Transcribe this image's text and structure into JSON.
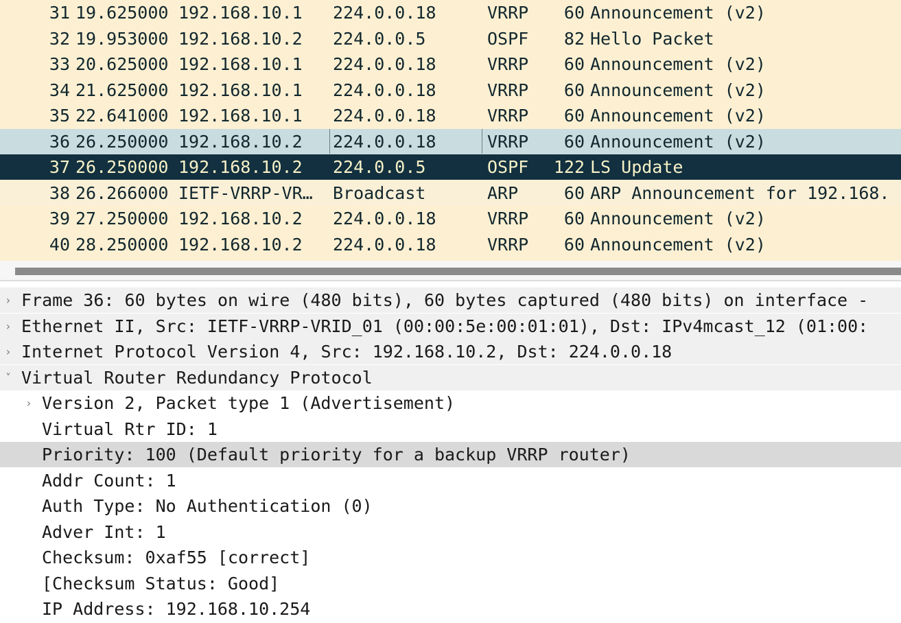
{
  "packet_list": {
    "rows": [
      {
        "no": "31",
        "time": "19.625000",
        "source": "192.168.10.1",
        "destination": "224.0.0.18",
        "protocol": "VRRP",
        "length": "60",
        "info": "Announcement (v2)",
        "style": "vrrp"
      },
      {
        "no": "32",
        "time": "19.953000",
        "source": "192.168.10.2",
        "destination": "224.0.0.5",
        "protocol": "OSPF",
        "length": "82",
        "info": "Hello Packet",
        "style": "ospf"
      },
      {
        "no": "33",
        "time": "20.625000",
        "source": "192.168.10.1",
        "destination": "224.0.0.18",
        "protocol": "VRRP",
        "length": "60",
        "info": "Announcement (v2)",
        "style": "vrrp"
      },
      {
        "no": "34",
        "time": "21.625000",
        "source": "192.168.10.1",
        "destination": "224.0.0.18",
        "protocol": "VRRP",
        "length": "60",
        "info": "Announcement (v2)",
        "style": "vrrp"
      },
      {
        "no": "35",
        "time": "22.641000",
        "source": "192.168.10.1",
        "destination": "224.0.0.18",
        "protocol": "VRRP",
        "length": "60",
        "info": "Announcement (v2)",
        "style": "vrrp"
      },
      {
        "no": "36",
        "time": "26.250000",
        "source": "192.168.10.2",
        "destination": "224.0.0.18",
        "protocol": "VRRP",
        "length": "60",
        "info": "Announcement (v2)",
        "style": "selected-soft"
      },
      {
        "no": "37",
        "time": "26.250000",
        "source": "192.168.10.2",
        "destination": "224.0.0.5",
        "protocol": "OSPF",
        "length": "122",
        "info": "LS Update",
        "style": "selected"
      },
      {
        "no": "38",
        "time": "26.266000",
        "source": "IETF-VRRP-VR…",
        "destination": "Broadcast",
        "protocol": "ARP",
        "length": "60",
        "info": "ARP Announcement for 192.168.",
        "style": "arp"
      },
      {
        "no": "39",
        "time": "27.250000",
        "source": "192.168.10.2",
        "destination": "224.0.0.18",
        "protocol": "VRRP",
        "length": "60",
        "info": "Announcement (v2)",
        "style": "vrrp"
      },
      {
        "no": "40",
        "time": "28.250000",
        "source": "192.168.10.2",
        "destination": "224.0.0.18",
        "protocol": "VRRP",
        "length": "60",
        "info": "Announcement (v2)",
        "style": "vrrp"
      }
    ]
  },
  "details": {
    "items": [
      {
        "level": 0,
        "arrow": "›",
        "text": "Frame 36: 60 bytes on wire (480 bits), 60 bytes captured (480 bits) on interface -",
        "style": "top"
      },
      {
        "level": 0,
        "arrow": "›",
        "text": "Ethernet II, Src: IETF-VRRP-VRID_01 (00:00:5e:00:01:01), Dst: IPv4mcast_12 (01:00:",
        "style": "top"
      },
      {
        "level": 0,
        "arrow": "›",
        "text": "Internet Protocol Version 4, Src: 192.168.10.2, Dst: 224.0.0.18",
        "style": "top"
      },
      {
        "level": 0,
        "arrow": "˅",
        "text": "Virtual Router Redundancy Protocol",
        "style": "top"
      },
      {
        "level": 1,
        "arrow": "›",
        "text": "Version 2, Packet type 1 (Advertisement)",
        "style": "child"
      },
      {
        "level": 1,
        "arrow": "",
        "text": "Virtual Rtr ID: 1",
        "style": "child"
      },
      {
        "level": 1,
        "arrow": "",
        "text": "Priority: 100 (Default priority for a backup VRRP router)",
        "style": "highlight"
      },
      {
        "level": 1,
        "arrow": "",
        "text": "Addr Count: 1",
        "style": "child"
      },
      {
        "level": 1,
        "arrow": "",
        "text": "Auth Type: No Authentication (0)",
        "style": "child"
      },
      {
        "level": 1,
        "arrow": "",
        "text": "Adver Int: 1",
        "style": "child"
      },
      {
        "level": 1,
        "arrow": "",
        "text": "Checksum: 0xaf55 [correct]",
        "style": "child"
      },
      {
        "level": 1,
        "arrow": "",
        "text": "[Checksum Status: Good]",
        "style": "child"
      },
      {
        "level": 1,
        "arrow": "",
        "text": "IP Address: 192.168.10.254",
        "style": "child"
      }
    ]
  },
  "colors": {
    "vrrp_row": "#fdf0d2",
    "selected_row": "#12303f",
    "selected_soft_row": "#c9dde0",
    "highlight_detail": "#d9d9d9"
  }
}
